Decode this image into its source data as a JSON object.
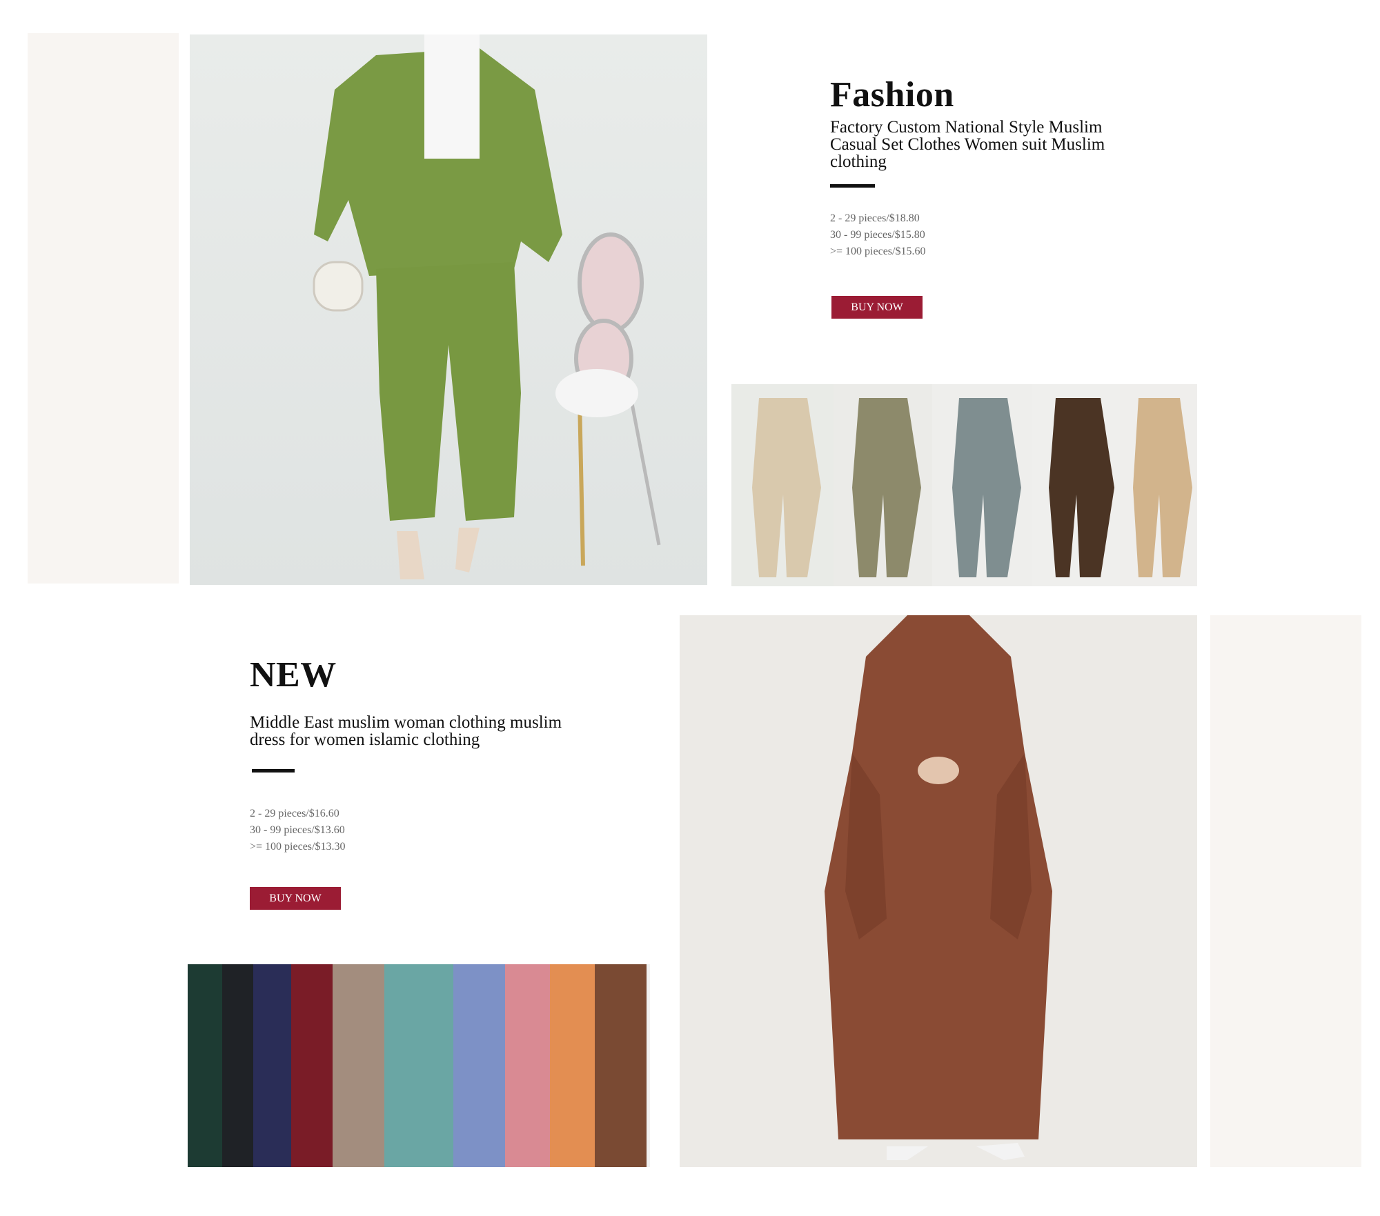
{
  "section1": {
    "kicker": "Fashion",
    "product_name": "Factory Custom National Style Muslim Casual Set Clothes Women suit Muslim clothing",
    "price_tiers": [
      "2 - 29 pieces/$18.80",
      "30 - 99 pieces/$15.80",
      ">= 100 pieces/$15.60"
    ],
    "buy_label": "BUY NOW",
    "hero_image": "green-two-piece-set-photo",
    "thumb_image": "set-color-variants-strip",
    "colors": {
      "suit": "#7a9a44",
      "variants": [
        "#d9c9ad",
        "#8d8a6b",
        "#7f8e90",
        "#4b3424",
        "#d2b48c"
      ]
    }
  },
  "section2": {
    "kicker": "NEW",
    "product_name": "Middle East muslim woman clothing muslim dress for women islamic clothing",
    "price_tiers": [
      "2 - 29 pieces/$16.60",
      "30 - 99 pieces/$13.60",
      ">= 100 pieces/$13.30"
    ],
    "buy_label": "BUY NOW",
    "hero_image": "brown-abaya-photo",
    "strip_image": "abaya-color-variants-strip",
    "colors": {
      "abaya": "#8a4b34",
      "variants": [
        "#1d3b33",
        "#1f2226",
        "#2a2d57",
        "#7a1c27",
        "#a38d7e",
        "#6aa6a4",
        "#7d91c6",
        "#d98a93",
        "#e38e52",
        "#7a4a33"
      ]
    }
  },
  "theme": {
    "accent": "#9b1c34",
    "panel": "#f8f5f2"
  }
}
